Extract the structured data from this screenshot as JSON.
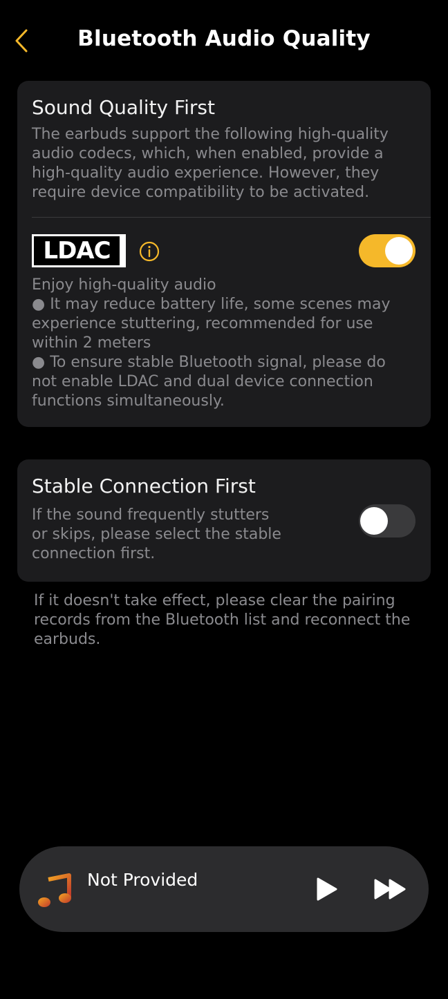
{
  "header": {
    "title": "Bluetooth Audio Quality",
    "back_icon": "chevron-left-icon"
  },
  "sound_quality": {
    "title": "Sound Quality First",
    "description": [
      "The earbuds support the following high-quality",
      "audio codecs, which, when enabled, provide a",
      "high-quality audio experience. However, they",
      "require device compatibility to be activated."
    ],
    "ldac": {
      "logo_text": "LDAC",
      "info_icon": "info-icon",
      "enabled": true,
      "details": [
        "Enjoy high-quality audio",
        "● It may reduce battery life, some scenes may",
        "experience stuttering, recommended for use",
        "within 2 meters",
        "● To ensure stable Bluetooth signal, please do",
        "not enable LDAC and dual device connection",
        "functions simultaneously."
      ]
    }
  },
  "stable_connection": {
    "title": "Stable Connection First",
    "description": [
      "If the sound frequently stutters",
      "or skips, please select the stable",
      "connection first."
    ],
    "enabled": false
  },
  "note": [
    "If it doesn't take effect, please clear the pairing",
    "records from the Bluetooth list and reconnect the",
    "earbuds."
  ],
  "player": {
    "track": "Not Provided",
    "music_icon": "music-note-icon",
    "play_icon": "play-icon",
    "next_icon": "fast-forward-icon"
  },
  "colors": {
    "accent": "#f5b82a",
    "background": "#000000",
    "card": "#1c1c1e",
    "secondary_text": "#8a8a8e"
  }
}
